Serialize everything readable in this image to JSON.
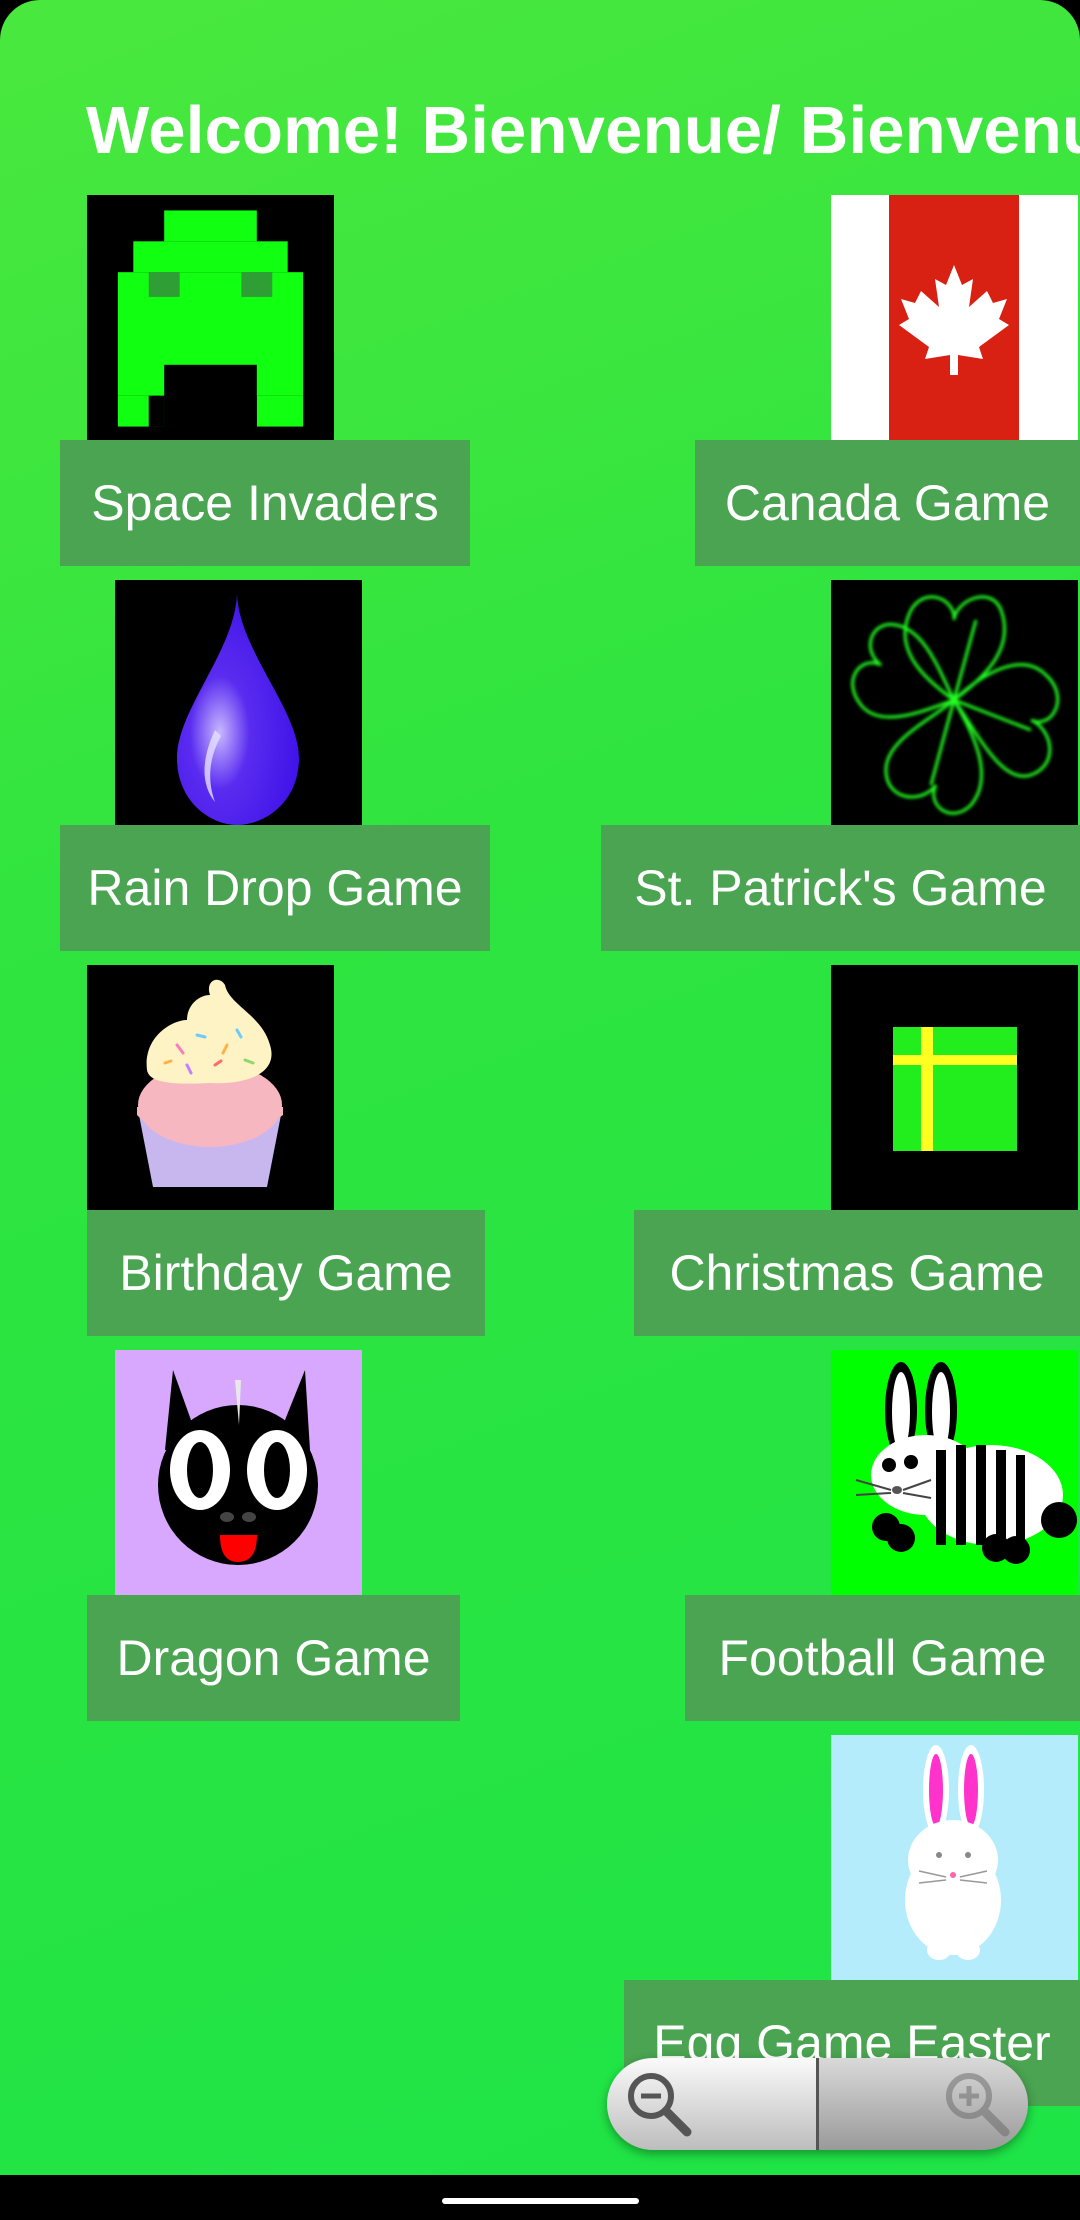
{
  "header": {
    "title": "Welcome! Bienvenue/ Bienvenu!"
  },
  "games": [
    {
      "label": "Space Invaders",
      "icon": "space-invader-icon"
    },
    {
      "label": "Canada Game",
      "icon": "canada-flag-icon"
    },
    {
      "label": "Rain Drop Game",
      "icon": "rain-drop-icon"
    },
    {
      "label": "St. Patrick's Game",
      "icon": "clover-icon"
    },
    {
      "label": "Birthday Game",
      "icon": "cupcake-icon"
    },
    {
      "label": "Christmas Game",
      "icon": "gift-box-icon"
    },
    {
      "label": "Dragon Game",
      "icon": "dragon-face-icon"
    },
    {
      "label": "Football Game",
      "icon": "zebra-icon"
    },
    {
      "label": "Egg Game Easter",
      "icon": "bunny-icon"
    }
  ],
  "zoom_controls": {
    "zoom_out": "zoom-out-icon",
    "zoom_in": "zoom-in-icon"
  },
  "colors": {
    "background": "#22e447",
    "button": "#4aa451",
    "text": "#ffffff"
  }
}
